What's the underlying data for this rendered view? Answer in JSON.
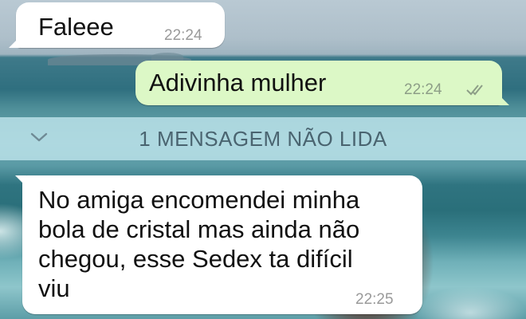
{
  "messages": [
    {
      "direction": "incoming",
      "text": "Faleee",
      "time": "22:24"
    },
    {
      "direction": "outgoing",
      "text": "Adivinha mulher",
      "time": "22:24",
      "status_icon": "double-check-icon"
    },
    {
      "direction": "incoming",
      "text": "No amiga encomendei minha\nbola de cristal mas ainda não\nchegou, esse Sedex ta difícil\nviu",
      "time": "22:25"
    }
  ],
  "unread_banner": {
    "label": "1 MENSAGEM NÃO LIDA",
    "icon": "chevron-down-icon"
  },
  "colors": {
    "incoming_bubble": "#ffffff",
    "outgoing_bubble": "#dcf8c6",
    "timestamp": "#9a9a9a",
    "unread_banner_bg": "#b9e1e8"
  }
}
